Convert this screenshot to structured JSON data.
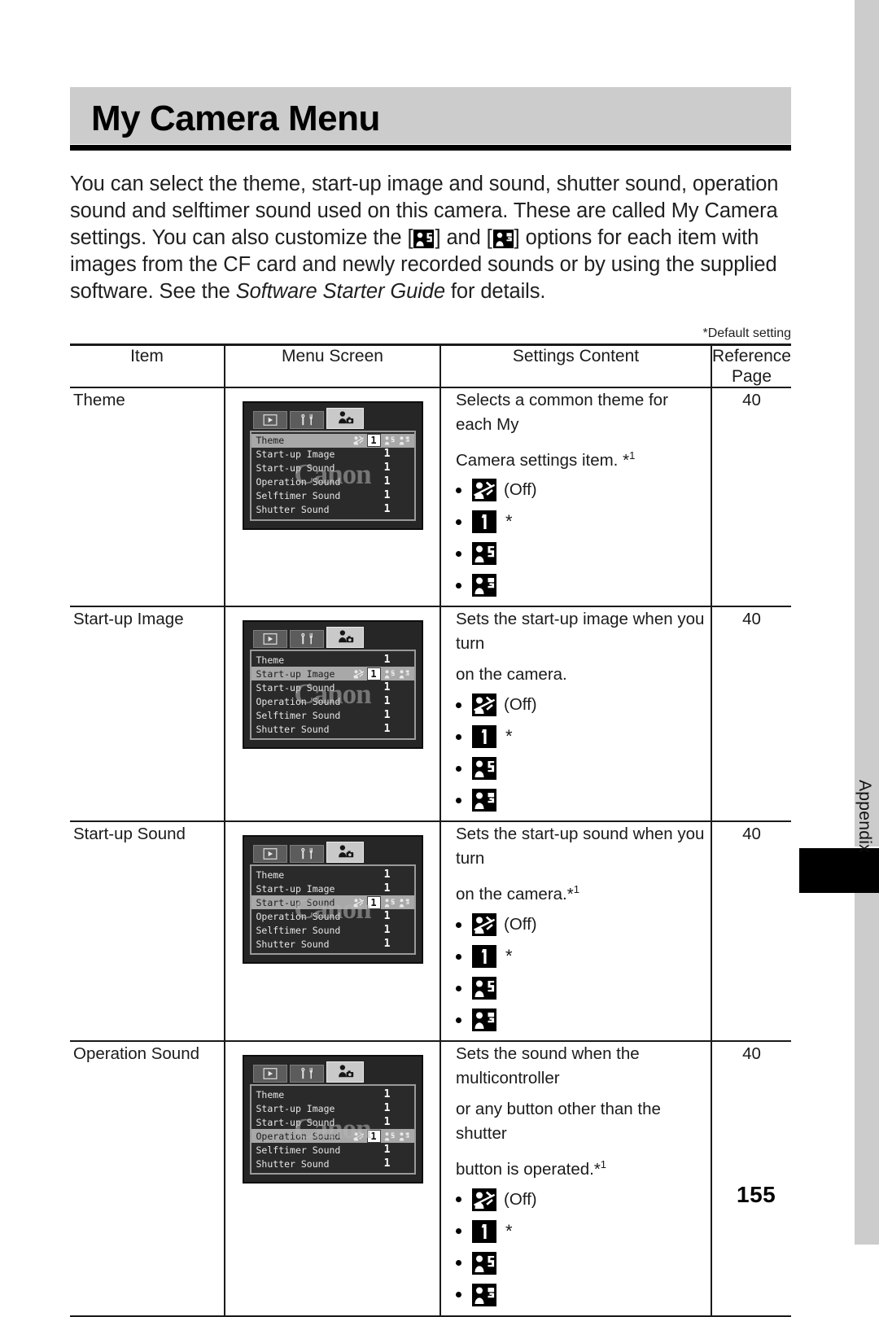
{
  "page": {
    "title": "My Camera Menu",
    "number": "155",
    "thumb_tab_label": "Appendix"
  },
  "intro": {
    "part1": "You can select the theme, start-up image and sound, shutter sound, operation sound and selftimer sound used on this camera. These are called My Camera settings. You can also customize the [",
    "icon1": "my-camera-2-icon",
    "part2": "] and [",
    "icon2": "my-camera-3-icon",
    "part3": "] options for each item with images from the CF card and newly recorded sounds or by using the supplied software. See the ",
    "italic": "Software Starter Guide",
    "part4": " for details."
  },
  "default_note": "*Default setting",
  "table": {
    "headers": {
      "item": "Item",
      "menu_screen": "Menu Screen",
      "settings_content": "Settings Content",
      "reference_page": "Reference Page"
    },
    "lcd_tabs": [
      "playback-tab-icon",
      "setup-tab-icon",
      "my-camera-tab-icon"
    ],
    "lcd_menu_items": [
      "Theme",
      "Start-up Image",
      "Start-up Sound",
      "Operation Sound",
      "Selftimer Sound",
      "Shutter Sound"
    ],
    "lcd_value": "1",
    "lcd_watermark": "Canon",
    "option_icons": [
      "off-icon",
      "my-camera-1-icon",
      "my-camera-2-icon",
      "my-camera-3-icon"
    ],
    "rows": [
      {
        "item": "Theme",
        "selected_index": 0,
        "desc": [
          "Selects a common theme for each My",
          "Camera settings item. *1"
        ],
        "options": [
          {
            "icon": "off-icon",
            "label": "(Off)",
            "default": false
          },
          {
            "icon": "my-camera-1-icon",
            "label": "",
            "default": true
          },
          {
            "icon": "my-camera-2-icon",
            "label": "",
            "default": false
          },
          {
            "icon": "my-camera-3-icon",
            "label": "",
            "default": false
          }
        ],
        "reference_page": "40"
      },
      {
        "item": "Start-up Image",
        "selected_index": 1,
        "desc": [
          "Sets the start-up image when you turn",
          "on the camera."
        ],
        "options": [
          {
            "icon": "off-icon",
            "label": "(Off)",
            "default": false
          },
          {
            "icon": "my-camera-1-icon",
            "label": "",
            "default": true
          },
          {
            "icon": "my-camera-2-icon",
            "label": "",
            "default": false
          },
          {
            "icon": "my-camera-3-icon",
            "label": "",
            "default": false
          }
        ],
        "reference_page": "40"
      },
      {
        "item": "Start-up Sound",
        "selected_index": 2,
        "desc": [
          "Sets the start-up sound when you turn",
          "on the camera.*1"
        ],
        "options": [
          {
            "icon": "off-icon",
            "label": "(Off)",
            "default": false
          },
          {
            "icon": "my-camera-1-icon",
            "label": "",
            "default": true
          },
          {
            "icon": "my-camera-2-icon",
            "label": "",
            "default": false
          },
          {
            "icon": "my-camera-3-icon",
            "label": "",
            "default": false
          }
        ],
        "reference_page": "40"
      },
      {
        "item": "Operation Sound",
        "selected_index": 3,
        "desc": [
          "Sets the sound when the multicontroller",
          "or any button other than the shutter",
          "button is operated.*1"
        ],
        "options": [
          {
            "icon": "off-icon",
            "label": "(Off)",
            "default": false
          },
          {
            "icon": "my-camera-1-icon",
            "label": "",
            "default": true
          },
          {
            "icon": "my-camera-2-icon",
            "label": "",
            "default": false
          },
          {
            "icon": "my-camera-3-icon",
            "label": "",
            "default": false
          }
        ],
        "reference_page": "40"
      }
    ]
  },
  "colors": {
    "title_band": "#cccccc",
    "rule": "#000000",
    "lcd_body": "#262626",
    "lcd_highlight": "#a8a8a8",
    "edge_strip": "#cccccc"
  }
}
